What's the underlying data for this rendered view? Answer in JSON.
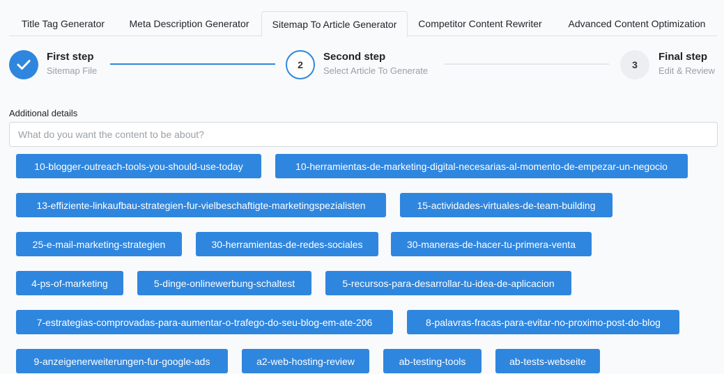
{
  "tabs": [
    {
      "label": "Title Tag Generator"
    },
    {
      "label": "Meta Description Generator"
    },
    {
      "label": "Sitemap To Article Generator",
      "active": true
    },
    {
      "label": "Competitor Content Rewriter"
    },
    {
      "label": "Advanced Content Optimization"
    }
  ],
  "steps": [
    {
      "number": "1",
      "title": "First step",
      "subtitle": "Sitemap File",
      "state": "done"
    },
    {
      "number": "2",
      "title": "Second step",
      "subtitle": "Select Article To Generate",
      "state": "current"
    },
    {
      "number": "3",
      "title": "Final step",
      "subtitle": "Edit & Review",
      "state": "todo"
    }
  ],
  "details": {
    "label": "Additional details",
    "value": "",
    "placeholder": "What do you want the content to be about?"
  },
  "articles": [
    "10-blogger-outreach-tools-you-should-use-today",
    "10-herramientas-de-marketing-digital-necesarias-al-momento-de-empezar-un-negocio",
    "13-effiziente-linkaufbau-strategien-fur-vielbeschaftigte-marketingspezialisten",
    "15-actividades-virtuales-de-team-building",
    "25-e-mail-marketing-strategien",
    "30-herramientas-de-redes-sociales",
    "30-maneras-de-hacer-tu-primera-venta",
    "4-ps-of-marketing",
    "5-dinge-onlinewerbung-schaltest",
    "5-recursos-para-desarrollar-tu-idea-de-aplicacion",
    "7-estrategias-comprovadas-para-aumentar-o-trafego-do-seu-blog-em-ate-206",
    "8-palavras-fracas-para-evitar-no-proximo-post-do-blog",
    "9-anzeigenerweiterungen-fur-google-ads",
    "a2-web-hosting-review",
    "ab-testing-tools",
    "ab-tests-webseite"
  ],
  "colors": {
    "accent": "#2f86de",
    "inactive_line": "#e3e6ea",
    "todo_circle": "#eceef1"
  }
}
